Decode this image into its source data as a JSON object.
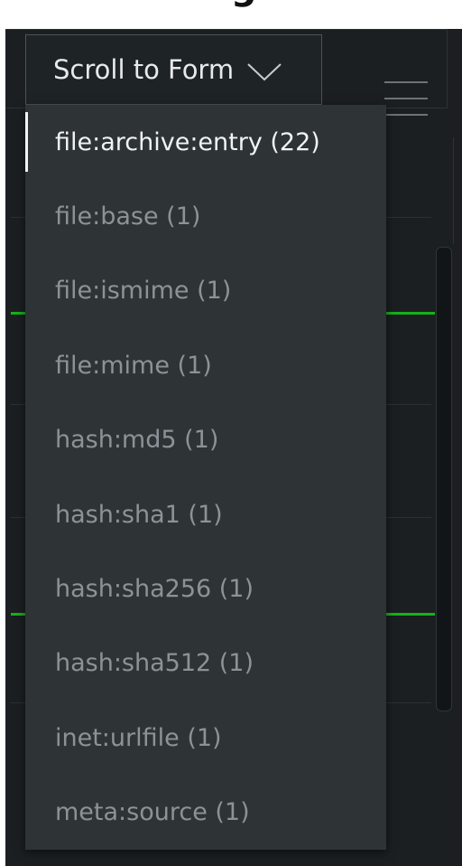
{
  "page_heading_partial": "ng",
  "header": {
    "scroll_button_label": "Scroll to Form"
  },
  "icons": {
    "dropdown_chevron": "chevron-down-icon",
    "menu": "hamburger-menu-icon"
  },
  "dropdown": {
    "selected_index": 0,
    "items": [
      {
        "label": "file:archive:entry (22)"
      },
      {
        "label": "file:base (1)"
      },
      {
        "label": "file:ismime (1)"
      },
      {
        "label": "file:mime (1)"
      },
      {
        "label": "hash:md5 (1)"
      },
      {
        "label": "hash:sha1 (1)"
      },
      {
        "label": "hash:sha256 (1)"
      },
      {
        "label": "hash:sha512 (1)"
      },
      {
        "label": "inet:urlfile (1)"
      },
      {
        "label": "meta:source (1)"
      }
    ]
  },
  "colors": {
    "panel_bg": "#1b1f22",
    "dropdown_bg": "#2e3336",
    "active_text": "#f1f3f4",
    "inactive_text": "#8c9397",
    "accent_green": "#16b11a"
  }
}
